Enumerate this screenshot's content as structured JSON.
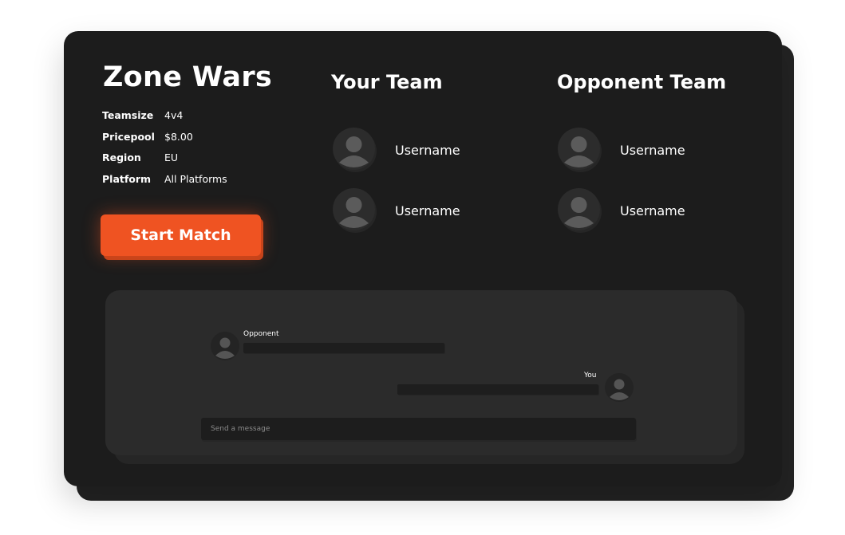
{
  "match": {
    "title": "Zone Wars",
    "details": [
      {
        "label": "Teamsize",
        "value": "4v4"
      },
      {
        "label": "Pricepool",
        "value": "$8.00"
      },
      {
        "label": "Region",
        "value": "EU"
      },
      {
        "label": "Platform",
        "value": "All Platforms"
      }
    ],
    "start_button_label": "Start Match"
  },
  "your_team": {
    "heading": "Your Team",
    "players": [
      {
        "name": "Username",
        "icon": "user-avatar-icon"
      },
      {
        "name": "Username",
        "icon": "user-avatar-icon"
      }
    ]
  },
  "opponent_team": {
    "heading": "Opponent Team",
    "players": [
      {
        "name": "Username",
        "icon": "user-avatar-icon"
      },
      {
        "name": "Username",
        "icon": "user-avatar-icon"
      }
    ]
  },
  "chat": {
    "messages": [
      {
        "sender": "Opponent",
        "icon": "user-avatar-icon"
      },
      {
        "sender": "You",
        "icon": "user-avatar-icon"
      }
    ],
    "input_placeholder": "Send a message"
  },
  "colors": {
    "accent": "#ef5322",
    "card_background": "#1c1c1c",
    "chat_background": "#2b2b2b"
  }
}
